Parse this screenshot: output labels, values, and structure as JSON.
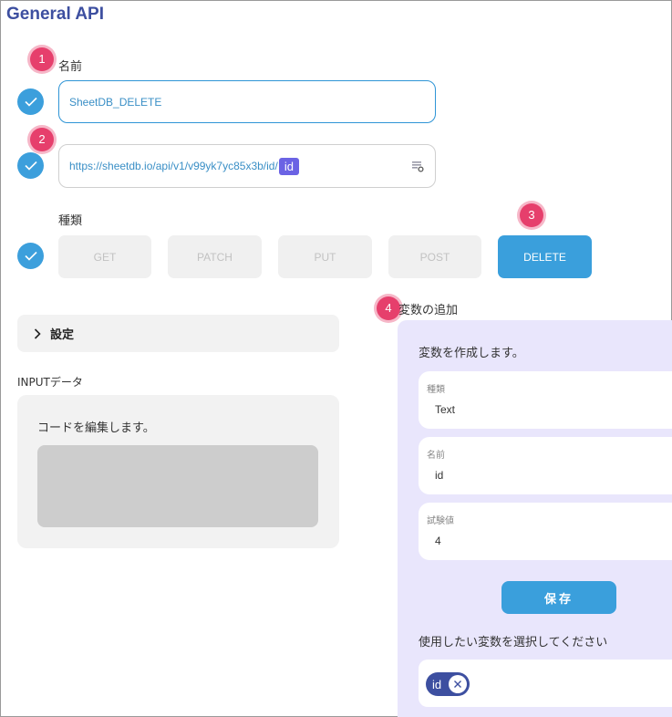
{
  "header": {
    "title": "General API"
  },
  "markers": [
    "1",
    "2",
    "3",
    "4"
  ],
  "name_section": {
    "label": "名前",
    "value": "SheetDB_DELETE"
  },
  "url_section": {
    "url_text": "https://sheetdb.io/api/v1/v99yk7yc85x3b/id/",
    "variable_chip": "id",
    "icon": "variable-insert-icon"
  },
  "method_section": {
    "label": "種類",
    "methods": [
      "GET",
      "PATCH",
      "PUT",
      "POST",
      "DELETE"
    ],
    "selected": "DELETE"
  },
  "settings": {
    "label": "設定",
    "icon": "chevron-right-icon"
  },
  "input_data": {
    "label": "INPUTデータ",
    "hint": "コードを編集します。"
  },
  "variables": {
    "section_label": "変数の追加",
    "heading": "変数を作成します。",
    "type_field": {
      "label": "種類",
      "value": "Text"
    },
    "name_field": {
      "label": "名前",
      "value": "id"
    },
    "test_field": {
      "label": "試験値",
      "value": "4"
    },
    "save_label": "保存",
    "select_prompt": "使用したい変数を選択してください",
    "selected_tags": [
      "id"
    ]
  },
  "colors": {
    "title": "#3d4fa0",
    "accent": "#3a9fdc",
    "marker": "#e63f6c",
    "chip": "#6b63e4",
    "panel_lavender": "#e9e6fc"
  }
}
